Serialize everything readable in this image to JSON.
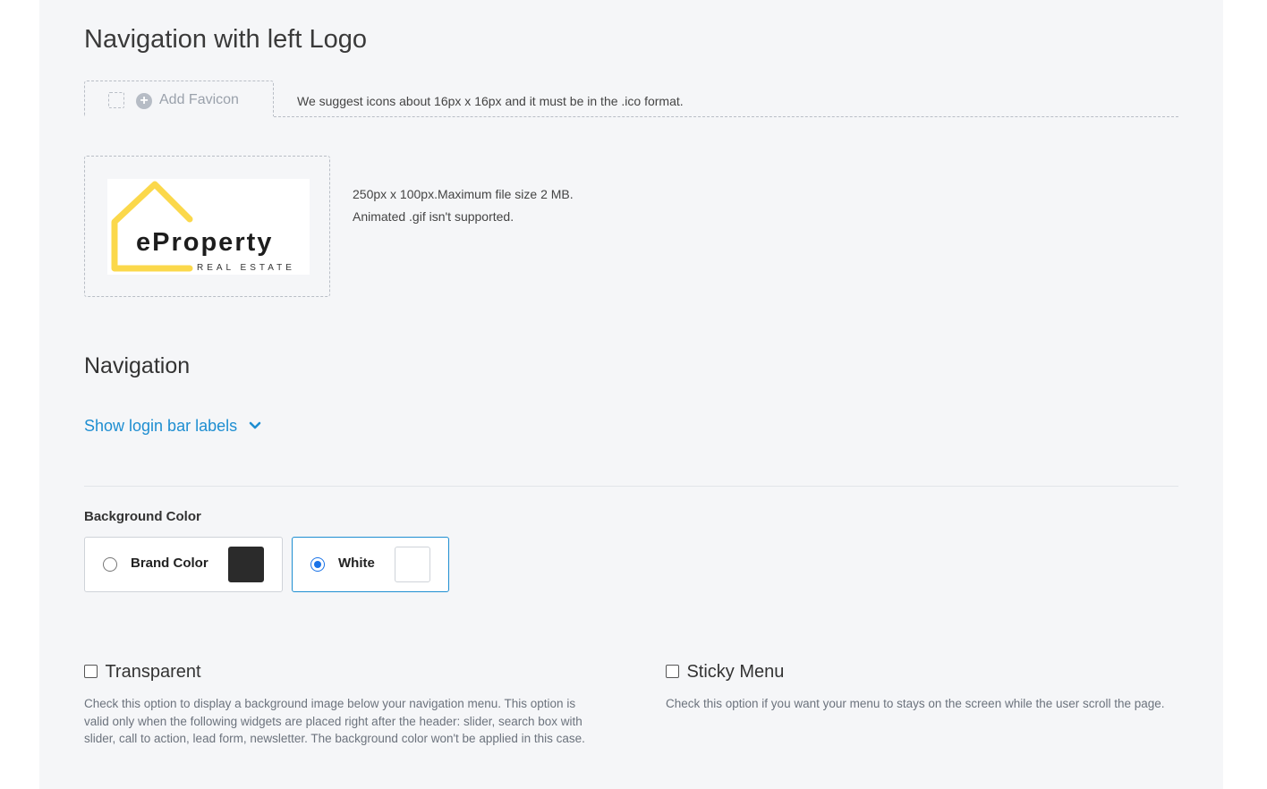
{
  "title": "Navigation with left Logo",
  "favicon": {
    "label": "Add Favicon",
    "hint": "We suggest icons about 16px x 16px and it must be in the .ico format."
  },
  "logo": {
    "brand_text": "eProperty",
    "brand_subtext": "REAL ESTATE",
    "hint_line1": "250px x 100px.Maximum file size 2 MB.",
    "hint_line2": "Animated .gif isn't supported."
  },
  "navigation": {
    "heading": "Navigation",
    "login_toggle_label": "Show login bar labels"
  },
  "background_color": {
    "label": "Background Color",
    "options": [
      {
        "label": "Brand Color",
        "swatch": "#2b2b2b",
        "selected": false
      },
      {
        "label": "White",
        "swatch": "#ffffff",
        "selected": true
      }
    ]
  },
  "transparent": {
    "label": "Transparent",
    "checked": false,
    "description": "Check this option to display a background image below your navigation menu. This option is valid only when the following widgets are placed right after the header: slider, search box with slider, call to action, lead form, newsletter. The background color won't be applied in this case."
  },
  "sticky_menu": {
    "label": "Sticky Menu",
    "checked": false,
    "description": "Check this option if you want your menu to stays on the screen while the user scroll the page."
  },
  "colors": {
    "accent": "#1e8ed1",
    "logo_yellow": "#fbd84b"
  }
}
